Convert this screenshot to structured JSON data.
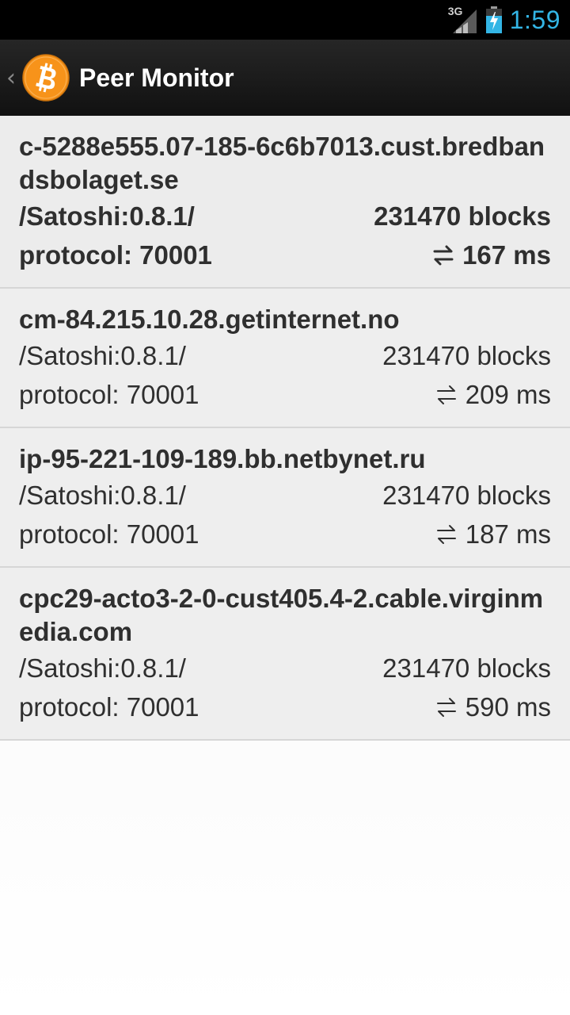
{
  "status_bar": {
    "network_type": "3G",
    "time": "1:59",
    "icons": [
      "signal-icon",
      "battery-charging-icon"
    ]
  },
  "action_bar": {
    "title": "Peer Monitor",
    "icons": [
      "up-caret-icon",
      "bitcoin-logo-icon"
    ]
  },
  "colors": {
    "status_bar_bg": "#000000",
    "clock_blue": "#33b5e5",
    "action_bar_bg": "#1a1a1a",
    "bitcoin_orange": "#f7931a",
    "list_bg": "#eeeeee",
    "text": "#2f2f2f"
  },
  "peers": [
    {
      "host": "c-5288e555.07-185-6c6b7013.cust.bredbandsbolaget.se",
      "user_agent": "/Satoshi:0.8.1/",
      "blocks": "231470 blocks",
      "protocol": "protocol: 70001",
      "ping": "167 ms"
    },
    {
      "host": "cm-84.215.10.28.getinternet.no",
      "user_agent": "/Satoshi:0.8.1/",
      "blocks": "231470 blocks",
      "protocol": "protocol: 70001",
      "ping": "209 ms"
    },
    {
      "host": "ip-95-221-109-189.bb.netbynet.ru",
      "user_agent": "/Satoshi:0.8.1/",
      "blocks": "231470 blocks",
      "protocol": "protocol: 70001",
      "ping": "187 ms"
    },
    {
      "host": "cpc29-acto3-2-0-cust405.4-2.cable.virginmedia.com",
      "user_agent": "/Satoshi:0.8.1/",
      "blocks": "231470 blocks",
      "protocol": "protocol: 70001",
      "ping": "590 ms"
    }
  ]
}
